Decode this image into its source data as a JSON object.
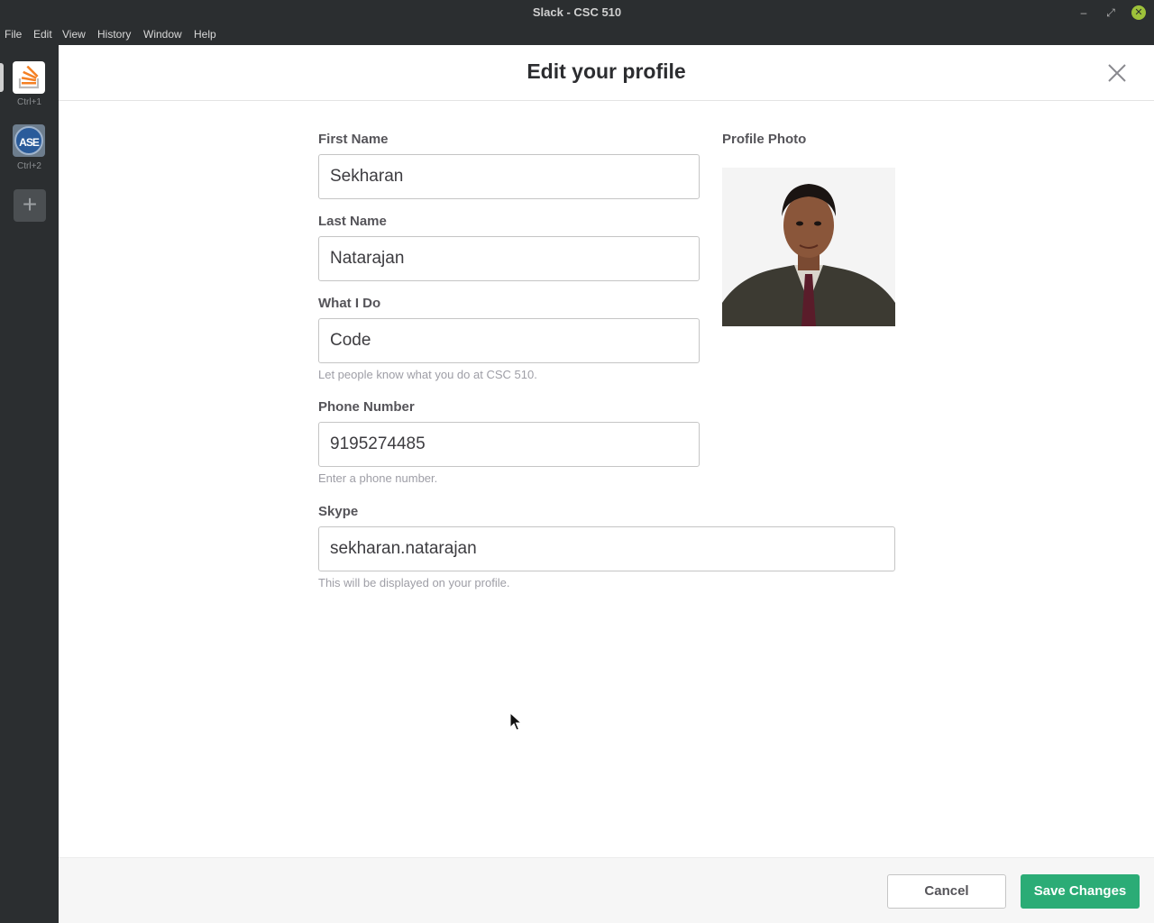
{
  "window": {
    "title": "Slack - CSC 510",
    "controls": [
      "minimize",
      "maximize",
      "close"
    ]
  },
  "menu": [
    "File",
    "Edit",
    "View",
    "History",
    "Window",
    "Help"
  ],
  "teams": [
    {
      "shortcut": "Ctrl+1",
      "icon": "stack-overflow-logo"
    },
    {
      "shortcut": "Ctrl+2",
      "icon": "ase-logo",
      "logo_text": "ASE"
    }
  ],
  "modal": {
    "title": "Edit your profile",
    "fields": {
      "first_name": {
        "label": "First Name",
        "value": "Sekharan"
      },
      "last_name": {
        "label": "Last Name",
        "value": "Natarajan"
      },
      "what_i_do": {
        "label": "What I Do",
        "value": "Code",
        "hint": "Let people know what you do at CSC 510."
      },
      "phone": {
        "label": "Phone Number",
        "value": "9195274485",
        "hint": "Enter a phone number."
      },
      "skype": {
        "label": "Skype",
        "value": "sekharan.natarajan",
        "hint": "This will be displayed on your profile."
      }
    },
    "photo_label": "Profile Photo",
    "cancel": "Cancel",
    "save": "Save Changes"
  },
  "colors": {
    "accent": "#2bac76",
    "sidebar": "#2b2e30"
  }
}
